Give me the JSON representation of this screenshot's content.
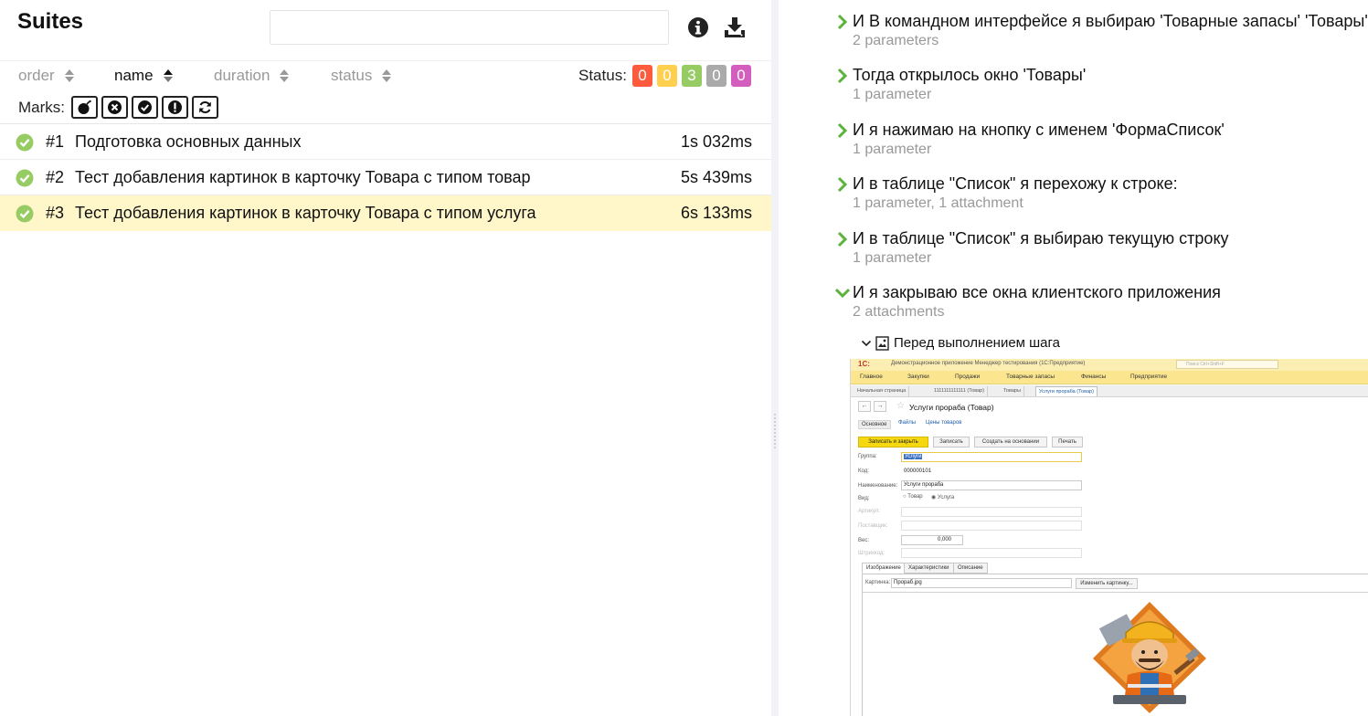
{
  "colors": {
    "passed": "#97cc64",
    "failed": "#fd5a3e",
    "broken": "#ffd050",
    "skipped": "#aaaaaa",
    "unknown": "#d35ebe",
    "selected_row": "#fff7c9",
    "step_chevron": "#5ab33a"
  },
  "header": {
    "title": "Suites",
    "search_placeholder": "",
    "icons": [
      "info-icon",
      "download-icon"
    ]
  },
  "sort": {
    "items": [
      {
        "label": "order",
        "active": false
      },
      {
        "label": "name",
        "active": true
      },
      {
        "label": "duration",
        "active": false
      },
      {
        "label": "status",
        "active": false
      }
    ]
  },
  "status_filter": {
    "label": "Status:",
    "counts": [
      {
        "name": "failed",
        "value": "0"
      },
      {
        "name": "broken",
        "value": "0"
      },
      {
        "name": "passed",
        "value": "3"
      },
      {
        "name": "skipped",
        "value": "0"
      },
      {
        "name": "unknown",
        "value": "0"
      }
    ]
  },
  "marks": {
    "label": "Marks:",
    "icons": [
      "bomb-icon",
      "close-circle-icon",
      "check-circle-icon",
      "exclamation-icon",
      "refresh-icon"
    ]
  },
  "tests": [
    {
      "num": "#1",
      "name": "Подготовка основных данных",
      "duration": "1s 032ms",
      "status": "passed",
      "selected": false
    },
    {
      "num": "#2",
      "name": "Тест добавления картинок в карточку Товара с типом товар",
      "duration": "5s 439ms",
      "status": "passed",
      "selected": false
    },
    {
      "num": "#3",
      "name": "Тест добавления картинок в карточку Товара с типом услуга",
      "duration": "6s 133ms",
      "status": "passed",
      "selected": true
    }
  ],
  "steps": [
    {
      "title": "И В командном интерфейсе я выбираю 'Товарные запасы' 'Товары'",
      "meta": "2 parameters",
      "expanded": false
    },
    {
      "title": "Тогда открылось окно 'Товары'",
      "meta": "1 parameter",
      "expanded": false
    },
    {
      "title": "И я нажимаю на кнопку с именем 'ФормаСписок'",
      "meta": "1 parameter",
      "expanded": false
    },
    {
      "title": "И в таблице \"Список\" я перехожу к строке:",
      "meta": "1 parameter, 1 attachment",
      "expanded": false
    },
    {
      "title": "И в таблице \"Список\" я выбираю текущую строку",
      "meta": "1 parameter",
      "expanded": false
    },
    {
      "title": "И я закрываю все окна клиентского приложения",
      "meta": "2 attachments",
      "expanded": true
    }
  ],
  "attachment": {
    "label": "Перед выполнением шага",
    "icon": "image-icon",
    "screenshot": {
      "logo": "1С:",
      "window_title": "Демонстрационное приложение   Менеджер тестирования (1С:Предприятие)",
      "search": "Поиск Ctrl+Shift+F",
      "menu": [
        "Главное",
        "Закупки",
        "Продажи",
        "Товарные запасы",
        "Финансы",
        "Предприятие"
      ],
      "tabs": [
        "Начальная страница",
        "1111111111111 (Товар)",
        "Товары",
        "Услуги прораба (Товар)"
      ],
      "form_title": "Услуги прораба (Товар)",
      "links": [
        "Основное",
        "Файлы",
        "Цены товаров"
      ],
      "buttons": [
        "Записать и закрыть",
        "Записать",
        "Создать на основании",
        "Печать"
      ],
      "fields": {
        "group_label": "Группа:",
        "group_value": "Услуги",
        "code_label": "Код:",
        "code_value": "000000101",
        "name_label": "Наименование:",
        "name_value": "Услуги прораба",
        "kind_label": "Вид:",
        "kind_goods": "Товар",
        "kind_service": "Услуга",
        "article_label": "Артикул:",
        "supplier_label": "Поставщик:",
        "weight_label": "Вес:",
        "weight_value": "0,000",
        "barcode_label": "Штрихкод:"
      },
      "inner_tabs": [
        "Изображение",
        "Характеристики",
        "Описание"
      ],
      "picture_label": "Картинка:",
      "picture_value": "Прораб.jpg",
      "change_picture_button": "Изменить картинку..."
    }
  }
}
